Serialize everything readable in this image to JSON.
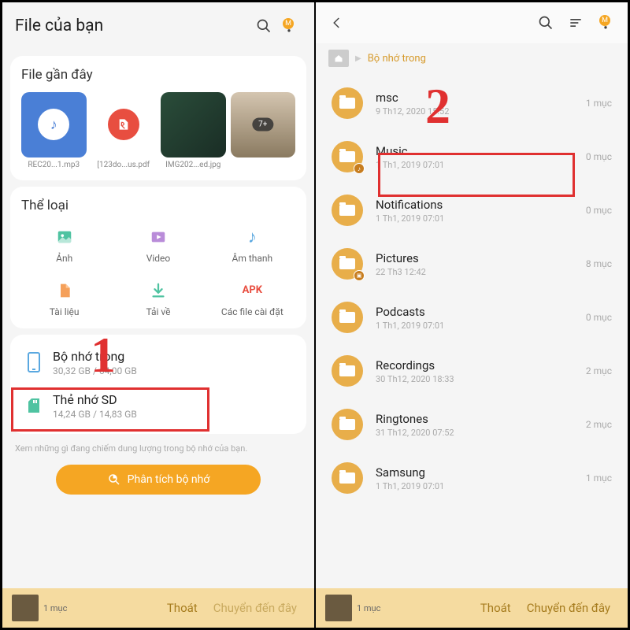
{
  "left": {
    "title": "File của bạn",
    "recent_title": "File gần đây",
    "recent_items": [
      {
        "name": "REC20...1.mp3"
      },
      {
        "name": "[123do...us.pdf"
      },
      {
        "name": "IMG202...ed.jpg"
      },
      {
        "name": ""
      }
    ],
    "recent_more_badge": "7+",
    "categories_title": "Thể loại",
    "categories": [
      {
        "label": "Ảnh"
      },
      {
        "label": "Video"
      },
      {
        "label": "Âm thanh"
      },
      {
        "label": "Tài liệu"
      },
      {
        "label": "Tải về"
      },
      {
        "label": "Các file cài đặt"
      }
    ],
    "apk_text": "APK",
    "storage": [
      {
        "name": "Bộ nhớ trong",
        "sub": "30,32 GB / 64,00 GB"
      },
      {
        "name": "Thẻ nhớ SD",
        "sub": "14,24 GB / 14,83 GB"
      }
    ],
    "footnote": "Xem những gì đang chiếm dung lượng trong bộ nhớ của bạn.",
    "analyze": "Phân tích bộ nhớ",
    "bottom": {
      "count": "1 mục",
      "exit": "Thoát",
      "move": "Chuyển đến đây"
    },
    "avatar_letter": "M"
  },
  "right": {
    "breadcrumb_current": "Bộ nhớ trong",
    "folders": [
      {
        "name": "msc",
        "date": "9 Th12, 2020 15:52",
        "count": "1 mục",
        "badge": ""
      },
      {
        "name": "Music",
        "date": "1 Th1, 2019 07:01",
        "count": "0 mục",
        "badge": "music"
      },
      {
        "name": "Notifications",
        "date": "1 Th1, 2019 07:01",
        "count": "0 mục",
        "badge": ""
      },
      {
        "name": "Pictures",
        "date": "22 Th3 12:42",
        "count": "8 mục",
        "badge": "image"
      },
      {
        "name": "Podcasts",
        "date": "1 Th1, 2019 07:01",
        "count": "0 mục",
        "badge": ""
      },
      {
        "name": "Recordings",
        "date": "30 Th12, 2020 18:33",
        "count": "2 mục",
        "badge": ""
      },
      {
        "name": "Ringtones",
        "date": "31 Th12, 2020 07:52",
        "count": "2 mục",
        "badge": ""
      },
      {
        "name": "Samsung",
        "date": "1 Th1, 2019 07:01",
        "count": "1 mục",
        "badge": ""
      }
    ],
    "bottom": {
      "count": "1 mục",
      "exit": "Thoát",
      "move": "Chuyển đến đây"
    },
    "avatar_letter": "M"
  },
  "annotations": {
    "num1": "1",
    "num2": "2"
  }
}
